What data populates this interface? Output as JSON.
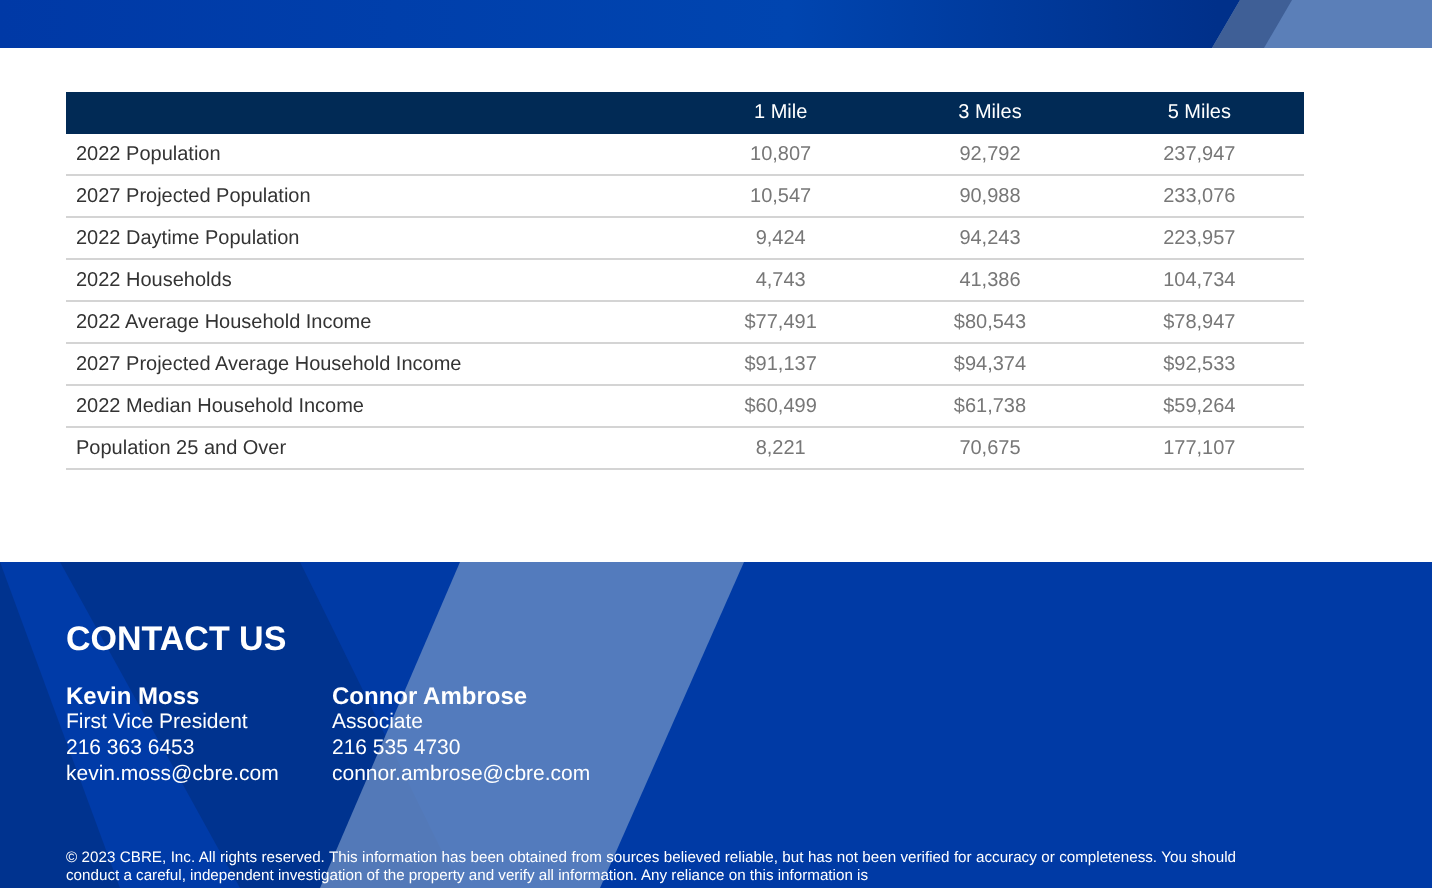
{
  "table": {
    "columns": [
      "",
      "1 Mile",
      "3 Miles",
      "5 Miles"
    ],
    "rows": [
      [
        "2022 Population",
        "10,807",
        "92,792",
        "237,947"
      ],
      [
        "2027 Projected Population",
        "10,547",
        "90,988",
        "233,076"
      ],
      [
        "2022 Daytime Population",
        "9,424",
        "94,243",
        "223,957"
      ],
      [
        "2022 Households",
        "4,743",
        "41,386",
        "104,734"
      ],
      [
        "2022 Average Household Income",
        "$77,491",
        "$80,543",
        "$78,947"
      ],
      [
        "2027 Projected Average Household Income",
        "$91,137",
        "$94,374",
        "$92,533"
      ],
      [
        "2022 Median Household Income",
        "$60,499",
        "$61,738",
        "$59,264"
      ],
      [
        "Population 25 and Over",
        "8,221",
        "70,675",
        "177,107"
      ]
    ]
  },
  "contact": {
    "title": "CONTACT US",
    "people": [
      {
        "name": "Kevin Moss",
        "role": "First Vice President",
        "phone": "216 363 6453",
        "email": "kevin.moss@cbre.com"
      },
      {
        "name": "Connor Ambrose",
        "role": "Associate",
        "phone": "216 535 4730",
        "email": "connor.ambrose@cbre.com"
      }
    ],
    "disclaimer": "© 2023 CBRE, Inc. All rights reserved. This information has been obtained from sources believed reliable, but has not been verified for accuracy or completeness. You should conduct a careful, independent investigation of the property and verify all information. Any reliance on this information is"
  }
}
